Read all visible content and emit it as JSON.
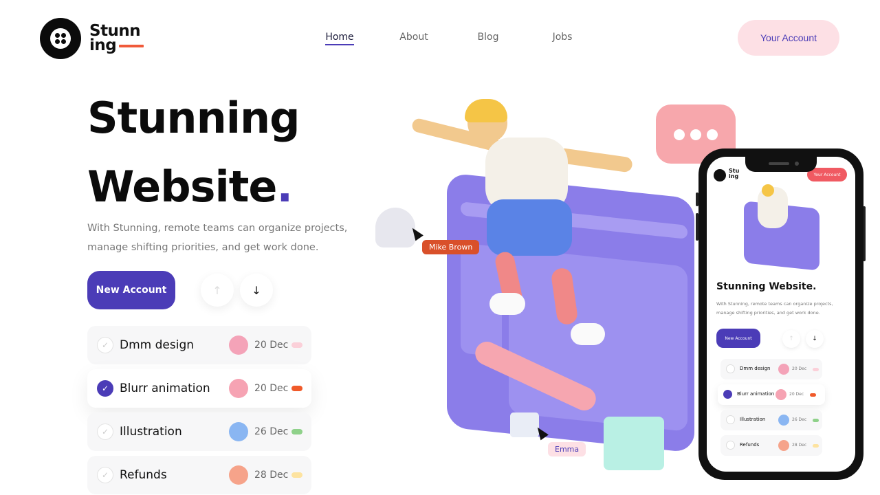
{
  "brand": {
    "logo_line1": "Stunn",
    "logo_line2": "ing"
  },
  "nav": {
    "items": [
      {
        "label": "Home",
        "active": true
      },
      {
        "label": "About",
        "active": false
      },
      {
        "label": "Blog",
        "active": false
      },
      {
        "label": "Jobs",
        "active": false
      }
    ]
  },
  "header": {
    "account_label": "Your Account"
  },
  "hero": {
    "title_line1": "Stunning",
    "title_line2": "Website",
    "title_dot": ".",
    "subtitle": "With Stunning, remote teams can organize projects, manage shifting priorities, and get work done.",
    "new_account_label": "New Account",
    "up_arrow_glyph": "↑",
    "down_arrow_glyph": "↓"
  },
  "tasks": [
    {
      "name": "Dmm design",
      "date": "20 Dec",
      "done": false,
      "avatar_color": "#f4a3b8",
      "pill_color": "#fbd0d9"
    },
    {
      "name": "Blurr animation",
      "date": "20 Dec",
      "done": true,
      "avatar_color": "#f6a3b3",
      "pill_color": "#f05a2a"
    },
    {
      "name": "Illustration",
      "date": "26 Dec",
      "done": false,
      "avatar_color": "#8ab6f2",
      "pill_color": "#8fd18a"
    },
    {
      "name": "Refunds",
      "date": "28 Dec",
      "done": false,
      "avatar_color": "#f6a38a",
      "pill_color": "#fde3a0"
    }
  ],
  "illustration": {
    "tag_mike": "Mike Brown",
    "tag_emma": "Emma"
  },
  "phone": {
    "logo_line1": "Stu",
    "logo_line2": "ing",
    "account_label": "Your Account",
    "title": "Stunning Website.",
    "subtitle": "With Stunning, remote teams can organize projects, manage shifting priorities, and get work done.",
    "new_account_label": "New Account",
    "tasks": [
      {
        "name": "Dmm design",
        "date": "20 Dec"
      },
      {
        "name": "Blurr animation",
        "date": "20 Dec"
      },
      {
        "name": "Illustration",
        "date": "26 Dec"
      },
      {
        "name": "Refunds",
        "date": "28 Dec"
      }
    ]
  },
  "colors": {
    "accent": "#4b3cb7",
    "account_bg": "#fde0e5",
    "logo_bar": "#f05a3a"
  }
}
